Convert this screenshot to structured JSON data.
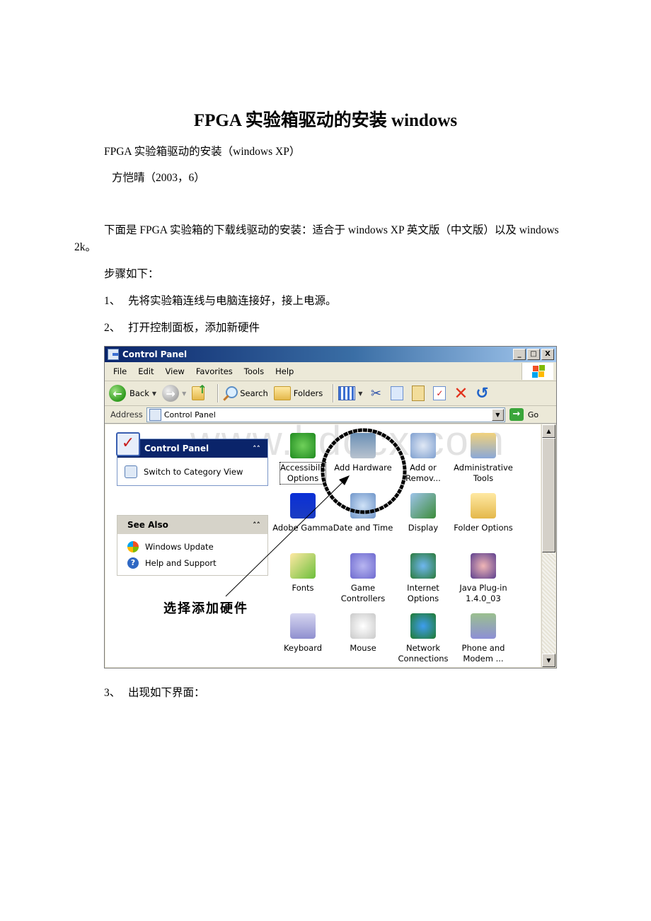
{
  "document": {
    "title": "FPGA 实验箱驱动的安装 windows",
    "subtitle": "FPGA 实验箱驱动的安装（windows XP）",
    "author_line": "方恺晴（2003，6）",
    "intro": "下面是 FPGA 实验箱的下载线驱动的安装：适合于 windows XP 英文版（中文版）以及 windows 2k。",
    "steps_label": "步骤如下：",
    "steps": [
      {
        "num": "1、",
        "text": "先将实验箱连线与电脑连接好，接上电源。"
      },
      {
        "num": "2、",
        "text": "打开控制面板，添加新硬件"
      },
      {
        "num": "3、",
        "text": "出现如下界面："
      }
    ]
  },
  "screenshot": {
    "window_title": "Control Panel",
    "title_buttons": {
      "minimize": "_",
      "maximize": "□",
      "close": "X"
    },
    "menu": [
      "File",
      "Edit",
      "View",
      "Favorites",
      "Tools",
      "Help"
    ],
    "toolbar": {
      "back": "Back",
      "search": "Search",
      "folders": "Folders"
    },
    "address": {
      "label": "Address",
      "value": "Control Panel",
      "go": "Go"
    },
    "task_pane": {
      "control_panel": {
        "title": "Control Panel",
        "links": [
          "Switch to Category View"
        ]
      },
      "see_also": {
        "title": "See Also",
        "links": [
          "Windows Update",
          "Help and Support"
        ]
      }
    },
    "items": [
      {
        "label": "Accessibility Options",
        "line1": "Accessibilit",
        "line2": "Options",
        "icon": "accessibility-icon",
        "selected": true
      },
      {
        "label": "Add Hardware",
        "line1": "Add Hardware",
        "line2": "",
        "icon": "add-hardware-icon"
      },
      {
        "label": "Add or Remove Programs",
        "line1": "Add or",
        "line2": "Remov...",
        "icon": "add-remove-programs-icon"
      },
      {
        "label": "Administrative Tools",
        "line1": "Administrative",
        "line2": "Tools",
        "icon": "administrative-tools-icon"
      },
      {
        "label": "Adobe Gamma",
        "line1": "Adobe Gamma",
        "line2": "",
        "icon": "adobe-gamma-icon"
      },
      {
        "label": "Date and Time",
        "line1": "Date and Time",
        "line2": "",
        "icon": "date-time-icon"
      },
      {
        "label": "Display",
        "line1": "Display",
        "line2": "",
        "icon": "display-icon"
      },
      {
        "label": "Folder Options",
        "line1": "Folder Options",
        "line2": "",
        "icon": "folder-options-icon"
      },
      {
        "label": "Fonts",
        "line1": "Fonts",
        "line2": "",
        "icon": "fonts-icon"
      },
      {
        "label": "Game Controllers",
        "line1": "Game",
        "line2": "Controllers",
        "icon": "game-controllers-icon"
      },
      {
        "label": "Internet Options",
        "line1": "Internet",
        "line2": "Options",
        "icon": "internet-options-icon"
      },
      {
        "label": "Java Plug-in 1.4.0_03",
        "line1": "Java Plug-in",
        "line2": "1.4.0_03",
        "icon": "java-plugin-icon"
      },
      {
        "label": "Keyboard",
        "line1": "Keyboard",
        "line2": "",
        "icon": "keyboard-icon"
      },
      {
        "label": "Mouse",
        "line1": "Mouse",
        "line2": "",
        "icon": "mouse-icon"
      },
      {
        "label": "Network Connections",
        "line1": "Network",
        "line2": "Connections",
        "icon": "network-connections-icon"
      },
      {
        "label": "Phone and Modem Options",
        "line1": "Phone and",
        "line2": "Modem ...",
        "icon": "phone-modem-icon"
      }
    ],
    "annotation": "选择添加硬件",
    "watermark": "www.bdocx.com"
  }
}
